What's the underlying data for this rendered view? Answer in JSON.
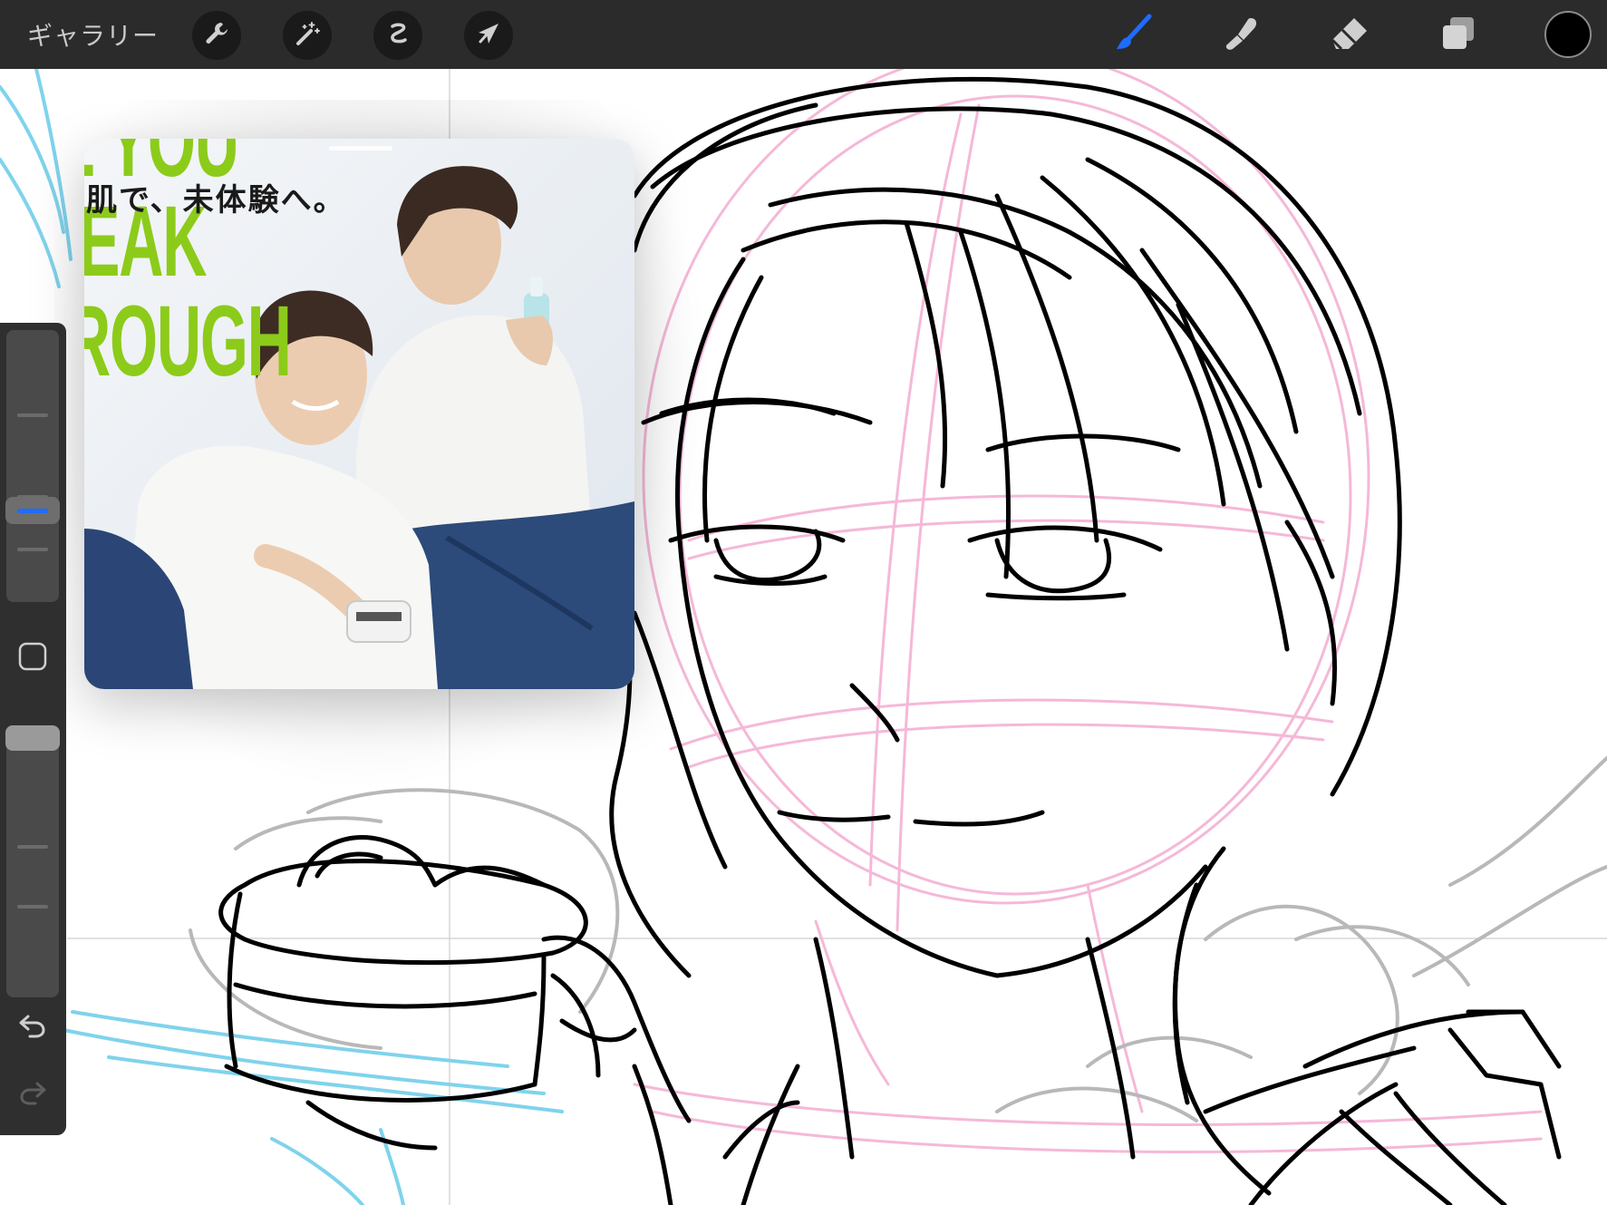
{
  "toolbar": {
    "gallery_label": "ギャラリー",
    "left_tools": [
      {
        "name": "actions",
        "icon": "wrench-icon"
      },
      {
        "name": "adjustments",
        "icon": "magic-wand-icon"
      },
      {
        "name": "selection",
        "icon": "selection-s-icon"
      },
      {
        "name": "transform",
        "icon": "arrow-cursor-icon"
      }
    ],
    "right_tools": [
      {
        "name": "brush",
        "icon": "brush-icon",
        "active": true,
        "active_color": "#1e6cff"
      },
      {
        "name": "smudge",
        "icon": "smudge-finger-icon"
      },
      {
        "name": "eraser",
        "icon": "eraser-icon"
      },
      {
        "name": "layers",
        "icon": "layers-icon"
      }
    ],
    "current_color": "#000000"
  },
  "reference": {
    "ad_text_lines": [
      "L YOU",
      "EAK",
      "ROUGH"
    ],
    "ad_tagline": "肌で、未体験へ。",
    "accent_color": "#8ccb1a"
  },
  "sidebar": {
    "brush_size_level": 0.4,
    "opacity_level": 0.05,
    "modify_button_icon": "square-modify-icon",
    "undo_icon": "undo-icon",
    "redo_icon": "redo-icon"
  },
  "sketch_colors": {
    "ink": "#000000",
    "construction": "#f5b8d8",
    "guide": "#7fd3ec",
    "rough": "#b8b8b8"
  }
}
